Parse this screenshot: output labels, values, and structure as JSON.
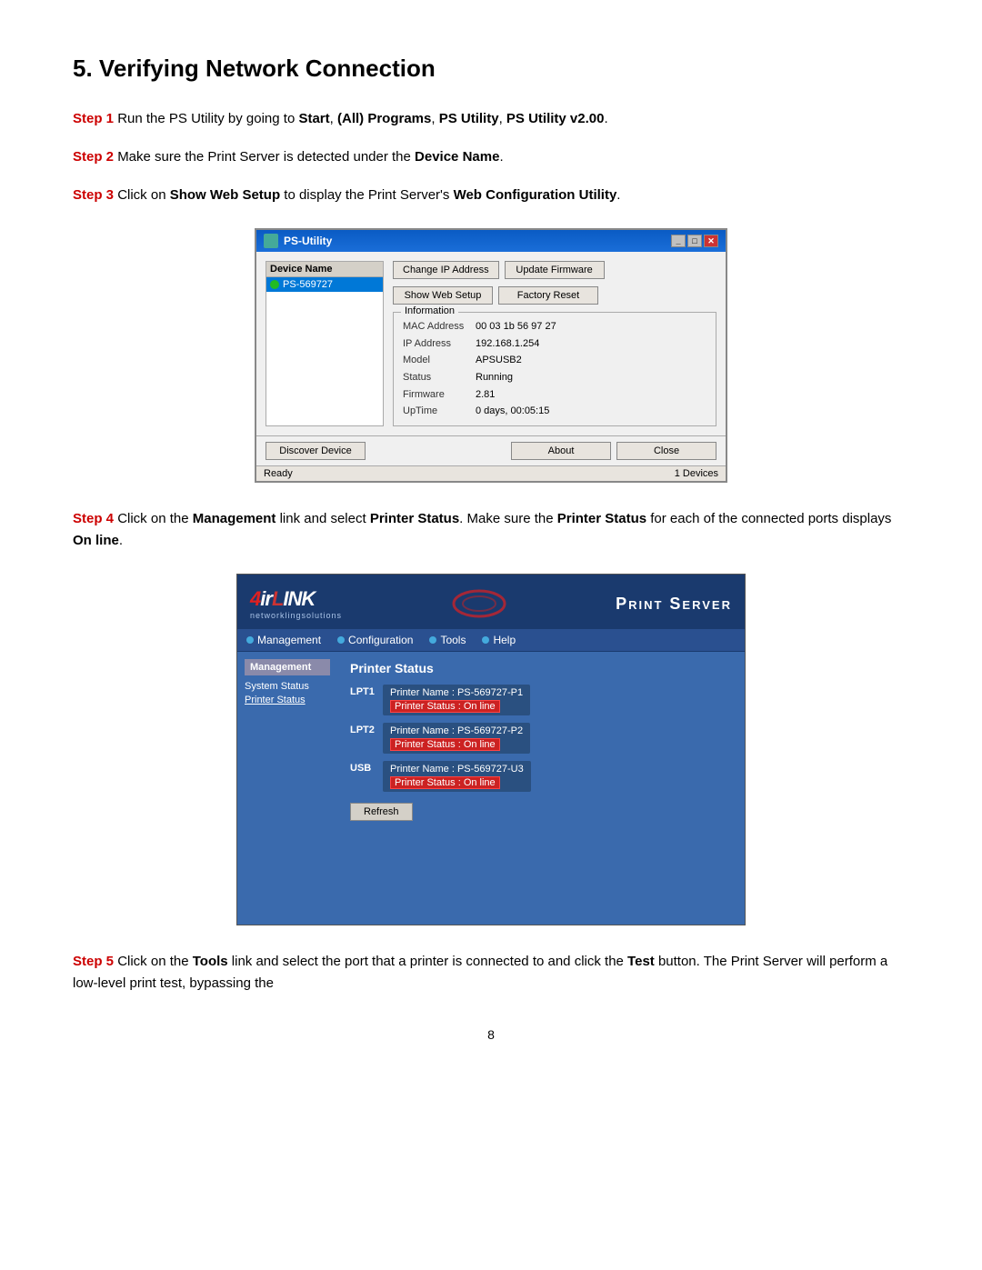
{
  "page": {
    "title": "5. Verifying Network Connection",
    "page_number": "8"
  },
  "steps": [
    {
      "label": "Step 1",
      "text": " Run the PS Utility by going to ",
      "bold_parts": [
        "Start",
        "(All) Programs",
        "PS Utility",
        "PS Utility v2.00"
      ],
      "full": "Run the PS Utility by going to Start, (All) Programs, PS Utility, PS Utility v2.00."
    },
    {
      "label": "Step 2",
      "text": " Make sure the Print Server is detected under the ",
      "bold": "Device Name",
      "full": "Make sure the Print Server is detected under the Device Name."
    },
    {
      "label": "Step 3",
      "text": " Click on ",
      "bold1": "Show Web Setup",
      "text2": " to display the Print Server’s ",
      "bold2": "Web Configuration Utility",
      "full": "Click on Show Web Setup to display the Print Server’s Web Configuration Utility."
    },
    {
      "label": "Step 4",
      "text1": " Click on the ",
      "bold1": "Management",
      "text2": " link and select ",
      "bold2": "Printer Status",
      "text3": ". Make sure the ",
      "bold3": "Printer Status",
      "text4": " for each of the connected ports displays ",
      "bold4": "On line",
      "text5": ".",
      "full": "Click on the Management link and select Printer Status. Make sure the Printer Status for each of the connected ports displays On line."
    },
    {
      "label": "Step 5",
      "text1": " Click on the ",
      "bold1": "Tools",
      "text2": " link and select the port that a printer is connected to and click the ",
      "bold2": "Test",
      "text3": " button. The Print Server will perform a low-level print test, bypassing the",
      "full": "Click on the Tools link and select the port that a printer is connected to and click the Test button. The Print Server will perform a low-level print test, bypassing the"
    }
  ],
  "ps_utility": {
    "title": "PS-Utility",
    "title_bar_controls": [
      "_",
      "□",
      "✕"
    ],
    "device_list_header": "Device Name",
    "device": "PS-569727",
    "buttons": {
      "change_ip": "Change IP Address",
      "update_firmware": "Update Firmware",
      "show_web_setup": "Show Web Setup",
      "factory_reset": "Factory Reset",
      "discover_device": "Discover Device",
      "about": "About",
      "close": "Close"
    },
    "info_group_label": "Information",
    "info": {
      "mac_label": "MAC Address",
      "mac_value": "00 03 1b 56 97 27",
      "ip_label": "IP Address",
      "ip_value": "192.168.1.254",
      "model_label": "Model",
      "model_value": "APSUSB2",
      "status_label": "Status",
      "status_value": "Running",
      "firmware_label": "Firmware",
      "firmware_value": "2.81",
      "uptime_label": "UpTime",
      "uptime_value": "0 days, 00:05:15"
    },
    "status_bar": {
      "left": "Ready",
      "right": "1 Devices"
    }
  },
  "web_ui": {
    "logo": "4IRLINK",
    "logo_sub": "networklingsolutions",
    "header_title": "Print Server",
    "nav_items": [
      "Management",
      "Configuration",
      "Tools",
      "Help"
    ],
    "sidebar_title": "Management",
    "sidebar_links": [
      "System Status",
      "Printer Status"
    ],
    "main_title": "Printer Status",
    "ports": [
      {
        "port": "LPT1",
        "name_label": "Printer Name",
        "name_value": "PS-569727-P1",
        "status_label": "Printer Status",
        "status_value": "On line"
      },
      {
        "port": "LPT2",
        "name_label": "Printer Name",
        "name_value": "PS-569727-P2",
        "status_label": "Printer Status",
        "status_value": "On line"
      },
      {
        "port": "USB",
        "name_label": "Printer Name",
        "name_value": "PS-569727-U3",
        "status_label": "Printer Status",
        "status_value": "On line"
      }
    ],
    "refresh_btn": "Refresh"
  }
}
